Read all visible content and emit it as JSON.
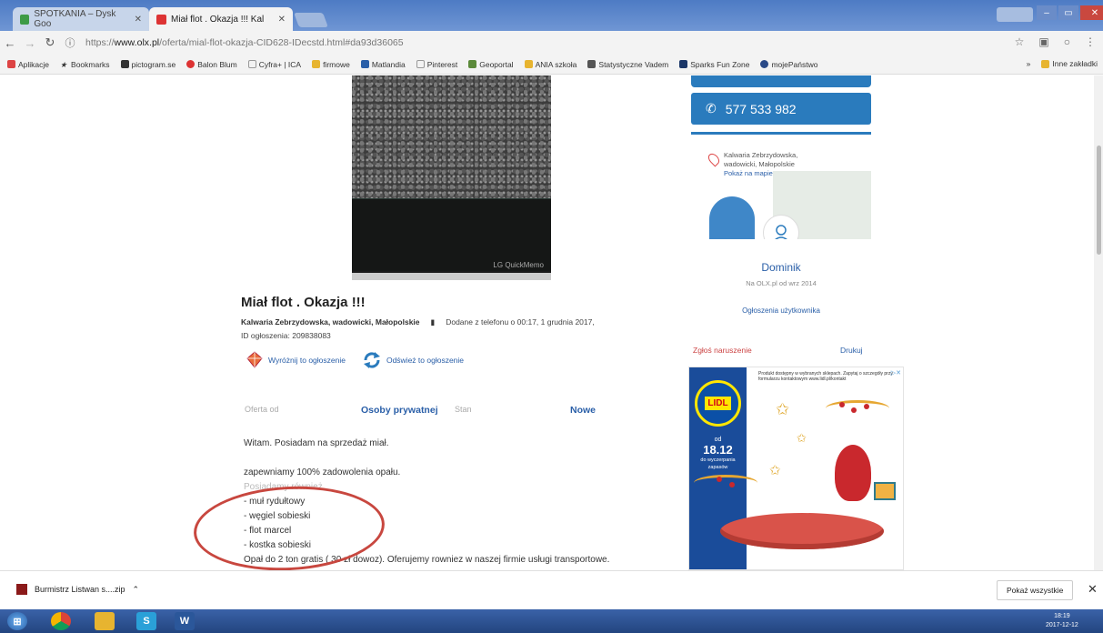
{
  "browser": {
    "tabs": [
      {
        "label": "SPOTKANIA – Dysk Goo",
        "active": false
      },
      {
        "label": "Miał flot . Okazja !!! Kal",
        "active": true
      }
    ],
    "url_prefix": "https://",
    "url_domain": "www.olx.pl",
    "url_path": "/oferta/mial-flot-okazja-CID628-IDecstd.html#da93d36065",
    "bookmarks": [
      "Aplikacje",
      "Bookmarks",
      "pictogram.se",
      "Balon Blum",
      "Cyfra+ | ICA",
      "firmowe",
      "Matlandia",
      "Pinterest",
      "Geoportal",
      "ANIA szkoła",
      "Statystyczne Vadem",
      "Sparks Fun Zone",
      "mojePaństwo"
    ],
    "other_bookmarks": "Inne zakładki"
  },
  "listing": {
    "photo_watermark": "LG QuickMemo",
    "title": "Miał flot . Okazja !!!",
    "location": "Kalwaria Zebrzydowska, wadowicki, Małopolskie",
    "added": "Dodane z telefonu  o 00:17, 1 grudnia 2017,",
    "ad_id": "ID ogłoszenia: 209838083",
    "actions": {
      "highlight": "Wyróżnij to ogłoszenie",
      "refresh": "Odśwież to ogłoszenie"
    },
    "details": {
      "offer_from_label": "Oferta od",
      "offer_from_value": "Osoby prywatnej",
      "state_label": "Stan",
      "state_value": "Nowe"
    },
    "description": [
      "Witam. Posiadam na sprzedaż miał.",
      "",
      "zapewniamy 100% zadowolenia opału.",
      "Posiadamy również",
      "- muł rydułtowy",
      "- węgiel sobieski",
      "- flot marcel",
      "- kostka sobieski",
      "Opał do 2 ton gratis ( 30 zł dowoz). Oferujemy rowniez w naszej firmie usługi transportowe."
    ]
  },
  "sidebar": {
    "phone": "577 533 982",
    "location": [
      "Kalwaria Zebrzydowska,",
      "wadowicki, Małopolskie"
    ],
    "map_link": "Pokaż na mapie",
    "user_name": "Dominik",
    "user_since": "Na OLX.pl od wrz 2014",
    "user_ads": "Ogłoszenia użytkownika",
    "report": "Zgłoś naruszenie",
    "print": "Drukuj"
  },
  "ad": {
    "brand": "LIDL",
    "note": "Produkt dostępny w wybranych sklepach. Zapytaj o szczegóły przy formularzu kontaktowym www.lidl.pl/kontakt",
    "od": "od",
    "date": "18.12",
    "small1": "do wyczerpania",
    "small2": "zapasów"
  },
  "downloads": {
    "file": "Burmistrz Listwan s....zip",
    "show_all": "Pokaż wszystkie"
  },
  "taskbar": {
    "time": "18:19",
    "date": "2017-12-12"
  },
  "colors": {
    "brand_blue": "#2a7bbd",
    "link_blue": "#2a5fa8",
    "annotation_red": "#c8473f"
  }
}
